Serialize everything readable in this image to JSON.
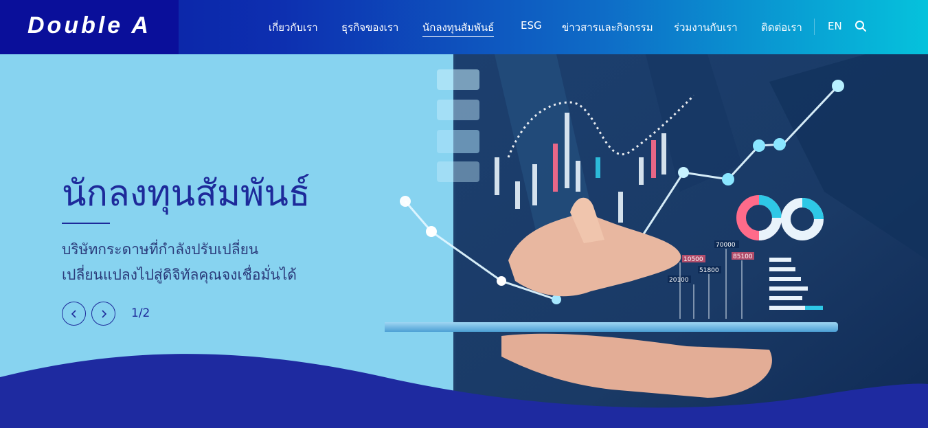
{
  "brand": {
    "logo_text": "Double A"
  },
  "nav": {
    "items": [
      {
        "label": "เกี่ยวกับเรา",
        "active": false
      },
      {
        "label": "ธุรกิจของเรา",
        "active": false
      },
      {
        "label": "นักลงทุนสัมพันธ์",
        "active": true
      },
      {
        "label": "ESG",
        "active": false
      },
      {
        "label": "ข่าวสารและกิจกรรม",
        "active": false
      },
      {
        "label": "ร่วมงานกับเรา",
        "active": false
      },
      {
        "label": "ติดต่อเรา",
        "active": false
      }
    ],
    "language": "EN",
    "search_icon": "search-icon"
  },
  "hero": {
    "title": "นักลงทุนสัมพันธ์",
    "subtitle_line1": "บริษัทกระดาษที่กำลังปรับเปลี่ยน",
    "subtitle_line2": "เปลี่ยนแปลงไปสู่ดิจิทัลคุณจงเชื่อมั่นได้",
    "pager": "1/2",
    "prev_icon": "chevron-left-icon",
    "next_icon": "chevron-right-icon",
    "chart_labels": [
      "70000",
      "10500",
      "85100",
      "51800",
      "20100"
    ]
  },
  "colors": {
    "header_left": "#0a0f9a",
    "header_right": "#05c2dc",
    "hero_bg": "#87d3f0",
    "title": "#1d2a9a",
    "wave": "#1e2aa0"
  }
}
